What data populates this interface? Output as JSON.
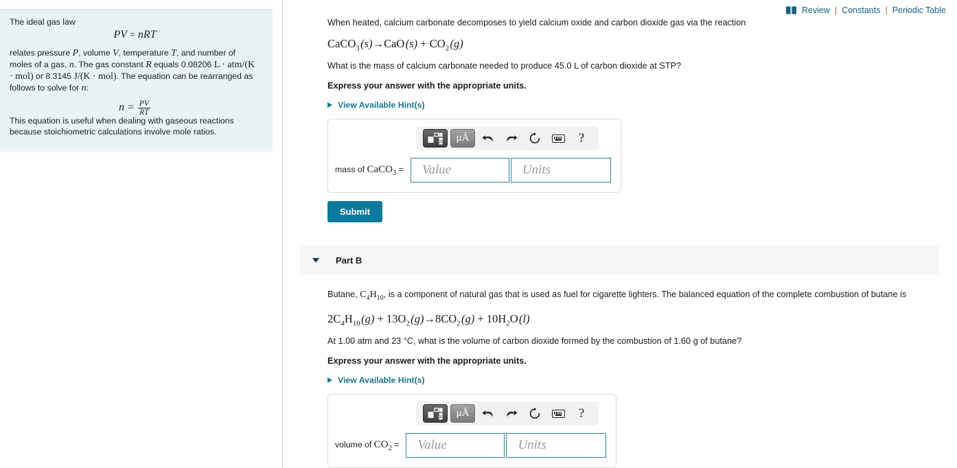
{
  "utility_nav": {
    "book_icon": "book-icon",
    "links": [
      "Review",
      "Constants",
      "Periodic Table"
    ],
    "separator": "|",
    "link_color": "#156380"
  },
  "reference_panel": {
    "intro": "The ideal gas law",
    "display_equation_1": "PV = nRT",
    "body_line_1": "relates pressure ",
    "var_P": "P",
    "body_line_1b": ", volume ",
    "var_V": "V",
    "body_line_1c": ", temperature ",
    "var_T": "T",
    "body_line_1d": ", and number of",
    "body_line_2a": "moles of a gas, ",
    "var_n": "n",
    "body_line_2b": ". The gas constant ",
    "var_R": "R",
    "body_line_2c": " equals 0.08206",
    "units_1": "L · atm/(K · mol)",
    "body_line_3a": " or 8.3145 ",
    "units_2": "J/(K · mol)",
    "body_line_3b": ". The equation can",
    "body_line_4": "be rearranged as follows to solve for ",
    "var_n2": "n",
    "colon": ":",
    "display_equation_2_lhs": "n =",
    "display_equation_2_num": "PV",
    "display_equation_2_den": "RT",
    "closing": "This equation is useful when dealing with gaseous reactions because stoichiometric calculations involve mole ratios.",
    "background_color": "#e8f4f4"
  },
  "part_a": {
    "intro_text": "When heated, calcium carbonate decomposes to yield calcium oxide and carbon dioxide gas via the reaction",
    "equation": "CaCO3 (s)→CaO (s) + CO2 (g)",
    "question_text": "What is the mass of calcium carbonate needed to produce 45.0 L of carbon dioxide at STP?",
    "instruction": "Express your answer with the appropriate units.",
    "hint_label": "View Available Hint(s)",
    "answer_label_prefix": "mass of ",
    "answer_label_chem": "CaCO3",
    "answer_label_equals": " =",
    "value_placeholder": "Value",
    "units_placeholder": "Units",
    "value_current": "",
    "units_current": "",
    "submit_label": "Submit",
    "toolbar": {
      "template_button": "math-template-icon",
      "units_button": "μÅ",
      "undo": "undo-icon",
      "redo": "redo-icon",
      "reset": "reset-icon",
      "keyboard": "keyboard-icon",
      "help": "?"
    }
  },
  "part_b": {
    "header_title": "Part B",
    "intro_text_a": "Butane, ",
    "intro_chem": "C4H10",
    "intro_text_b": ", is a component of natural gas that is used as fuel for cigarette lighters. The balanced equation of the complete combustion of butane is",
    "equation": "2C4H10 (g) + 13O2 (g)→8CO2 (g) + 10H2O (l)",
    "question_text": "At 1.00 atm and 23 °C, what is the volume of carbon dioxide formed by the combustion of 1.60 g of butane?",
    "instruction": "Express your answer with the appropriate units.",
    "hint_label": "View Available Hint(s)",
    "answer_label_prefix": "volume of ",
    "answer_label_chem": "CO2",
    "answer_label_equals": " =",
    "value_placeholder": "Value",
    "units_placeholder": "Units",
    "value_current": "",
    "units_current": "",
    "toolbar": {
      "template_button": "math-template-icon",
      "units_button": "μÅ",
      "undo": "undo-icon",
      "redo": "redo-icon",
      "reset": "reset-icon",
      "keyboard": "keyboard-icon",
      "help": "?"
    }
  },
  "colors": {
    "accent_teal": "#0b7a9e",
    "link_teal": "#15788f",
    "panel_bg": "#e8f4f4",
    "band_bg": "#f7f7f7"
  }
}
